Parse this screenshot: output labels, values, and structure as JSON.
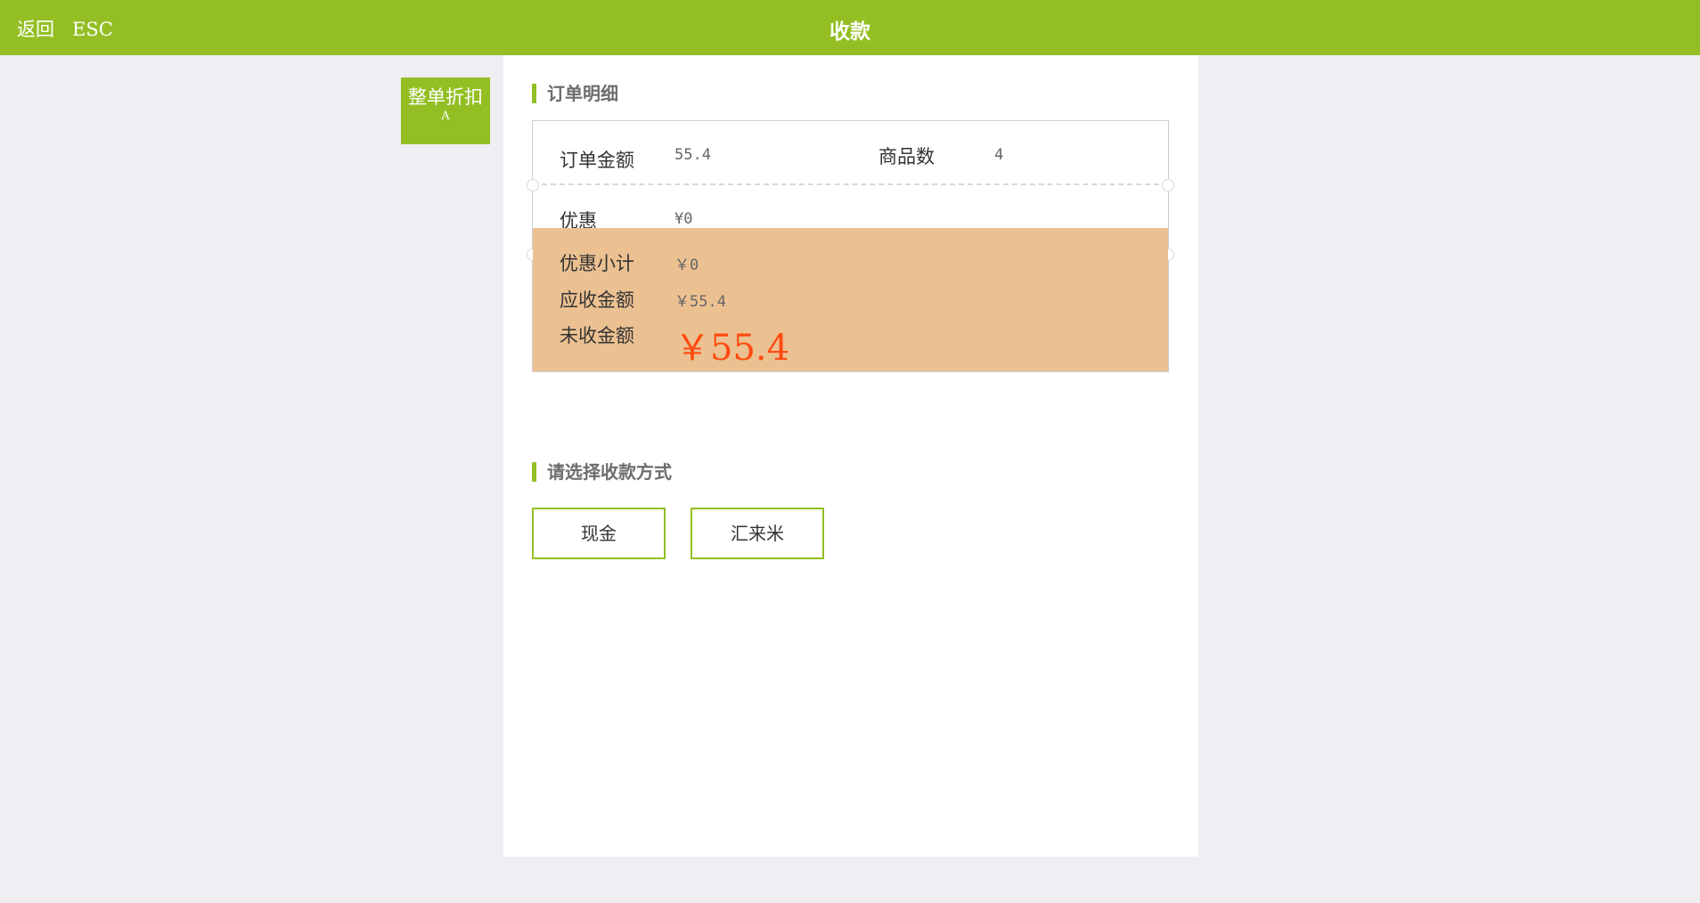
{
  "header": {
    "back_label": "返回",
    "esc_label": "ESC",
    "title": "收款"
  },
  "side_button": {
    "label": "整单折扣",
    "shortcut": "A"
  },
  "order_detail": {
    "section_title": "订单明细",
    "order_amount_label": "订单金额",
    "order_amount_value": "55.4",
    "item_count_label": "商品数",
    "item_count_value": "4",
    "discount_label": "优惠",
    "discount_value": "¥0",
    "discount_subtotal_label": "优惠小计",
    "discount_subtotal_value": "￥0",
    "receivable_label": "应收金额",
    "receivable_value": "￥55.4",
    "unpaid_label": "未收金额",
    "unpaid_value": "￥55.4"
  },
  "payment": {
    "section_title": "请选择收款方式",
    "methods": [
      "现金",
      "汇来米"
    ]
  },
  "colors": {
    "brand_green": "#93bf24",
    "summary_bg": "#ecc191",
    "unpaid_text": "#ff4a10",
    "page_bg": "#efeef3"
  }
}
